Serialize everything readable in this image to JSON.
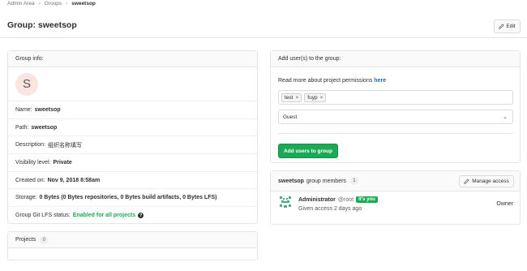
{
  "breadcrumb": [
    "Admin Area",
    "Groups",
    "sweetsop"
  ],
  "page": {
    "title": "Group: sweetsop",
    "edit_label": "Edit"
  },
  "group_info": {
    "header": "Group info:",
    "avatar_letter": "S",
    "name_label": "Name:",
    "name": "sweetsop",
    "path_label": "Path:",
    "path": "sweetsop",
    "description_label": "Description:",
    "description": "组织名称填写",
    "visibility_label": "Visibility level:",
    "visibility": "Private",
    "created_label": "Created on:",
    "created": "Nov 9, 2018 8:58am",
    "storage_label": "Storage:",
    "storage": "0 Bytes (0 Bytes repositories, 0 Bytes build artifacts, 0 Bytes LFS)",
    "lfs_label": "Group Git LFS status:",
    "lfs_status": "Enabled for all projects"
  },
  "projects": {
    "label": "Projects",
    "count": "0"
  },
  "add_users": {
    "header": "Add user(s) to the group:",
    "perm_text": "Read more about project permissions",
    "perm_link": "here",
    "tokens": [
      "test",
      "fuyp"
    ],
    "role": "Guest",
    "button": "Add users to group"
  },
  "members": {
    "group": "sweetsop",
    "title_suffix": "group members",
    "count": "1",
    "manage_label": "Manage access",
    "list": [
      {
        "name": "Administrator",
        "handle": "@root",
        "badge": "It's you",
        "access": "Given access 2 days ago",
        "role": "Owner"
      }
    ]
  },
  "colors": {
    "accent_green": "#1aaa55",
    "link_blue": "#1b69b6"
  }
}
